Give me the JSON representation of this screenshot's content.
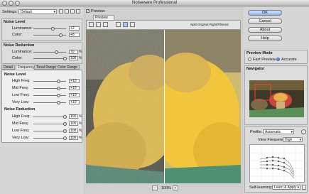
{
  "window": {
    "title": "Noiseware Professional"
  },
  "settings": {
    "label": "Settings:",
    "value": "Default"
  },
  "noise_level": {
    "heading": "Noise Level",
    "luminance_label": "Luminance:",
    "luminance_value": "+2",
    "color_label": "Color:",
    "color_value": "+8"
  },
  "noise_reduction": {
    "heading": "Noise Reduction",
    "luminance_label": "Luminance:",
    "luminance_value": "70",
    "luminance_level": 0.7,
    "color_label": "Color:",
    "color_value": "100",
    "color_level": 1.0,
    "unit": "%"
  },
  "tabs": [
    "Detail",
    "Frequency",
    "Tonal Range",
    "Color Range"
  ],
  "active_tab": "Frequency",
  "freq_noise_level": {
    "heading": "Noise Level",
    "rows": [
      {
        "label": "High Freq:",
        "value": "+10"
      },
      {
        "label": "Mid Freq:",
        "value": "+10"
      },
      {
        "label": "Low Freq:",
        "value": "+10"
      },
      {
        "label": "Very Low:",
        "value": "+10"
      }
    ]
  },
  "freq_noise_reduction": {
    "heading": "Noise Reduction",
    "rows": [
      {
        "label": "High Freq:",
        "value": "100",
        "level": 1.0
      },
      {
        "label": "Mid Freq:",
        "value": "100",
        "level": 1.0
      },
      {
        "label": "Low Freq:",
        "value": "100",
        "level": 1.0
      },
      {
        "label": "Very Low:",
        "value": "100",
        "level": 1.0
      }
    ],
    "unit": "%"
  },
  "preview": {
    "label": "Preview",
    "tab": "Preview",
    "split_label": "Split Original Right/Filtered",
    "zoom": "100%",
    "tools": [
      "hand-icon",
      "zoom-icon",
      "fit-icon",
      "single-view-icon",
      "split-vertical-icon",
      "split-horizontal-icon"
    ]
  },
  "buttons": {
    "ok": "OK",
    "cancel": "Cancel",
    "about": "About",
    "help": "Help"
  },
  "preview_mode": {
    "heading": "Preview Mode",
    "fast": "Fast Preview",
    "accurate": "Accurate",
    "selected": "Accurate"
  },
  "navigator": {
    "heading": "Navigator"
  },
  "profile": {
    "label": "Profile:",
    "value": "Automatic",
    "view_label": "View Frequency:",
    "view_value": "High",
    "self_learning_label": "Self-learning:",
    "self_learning_value": "Learn & Apply"
  },
  "colors": {
    "accent": "#5f95d6",
    "panel": "#d6d6d6",
    "window": "#c9c9c9"
  }
}
